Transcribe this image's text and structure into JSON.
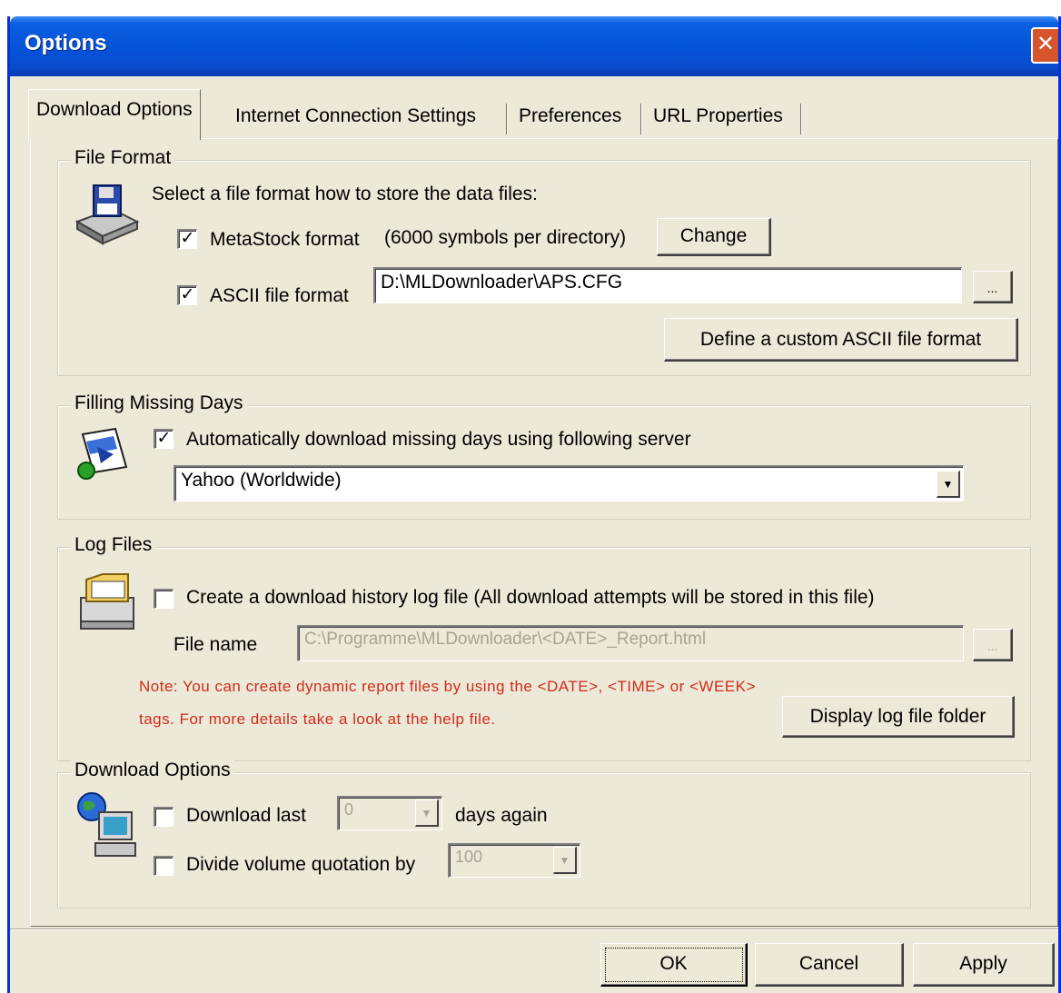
{
  "window": {
    "title": "Options",
    "close_glyph": "✕"
  },
  "tabs": [
    {
      "label": "Download Options",
      "active": true
    },
    {
      "label": "Internet Connection Settings",
      "active": false
    },
    {
      "label": "Preferences",
      "active": false
    },
    {
      "label": "URL Properties",
      "active": false
    }
  ],
  "file_format": {
    "title": "File Format",
    "description": "Select a file format how to store the data files:",
    "metastock": {
      "checked": true,
      "label": "MetaStock format",
      "note": "(6000 symbols per directory)",
      "change_label": "Change"
    },
    "ascii": {
      "checked": true,
      "label": "ASCII file format",
      "path": "D:\\MLDownloader\\APS.CFG",
      "browse_label": "..."
    },
    "define_label": "Define a custom ASCII file format"
  },
  "filling_missing_days": {
    "title": "Filling Missing Days",
    "auto_checked": true,
    "auto_label": "Automatically download missing days using following server",
    "server_selected": "Yahoo (Worldwide)"
  },
  "log_files": {
    "title": "Log Files",
    "create_checked": false,
    "create_label": "Create a download history log file (All download attempts will be stored in this file)",
    "file_name_label": "File name",
    "file_name_value": "C:\\Programme\\MLDownloader\\<DATE>_Report.html",
    "browse_label": "...",
    "note_line1": "Note: You can create dynamic report files by using the <DATE>, <TIME> or <WEEK>",
    "note_line2": "tags. For more details take a look at the help file.",
    "display_folder_label": "Display log file folder"
  },
  "download_options": {
    "title": "Download Options",
    "download_last_checked": false,
    "download_last_label": "Download last",
    "download_last_value": "0",
    "days_again_label": "days again",
    "divide_checked": false,
    "divide_label": "Divide volume quotation by",
    "divide_value": "100"
  },
  "footer": {
    "ok_label": "OK",
    "cancel_label": "Cancel",
    "apply_label": "Apply"
  },
  "colors": {
    "titlebar": "#0553d8",
    "dialog_bg": "#ece9d8",
    "note_text": "#d32a1a",
    "close_button": "#d8542c"
  },
  "icons": [
    "disk-drive-icon",
    "refresh-document-icon",
    "folder-printer-icon",
    "globe-computer-icon"
  ]
}
